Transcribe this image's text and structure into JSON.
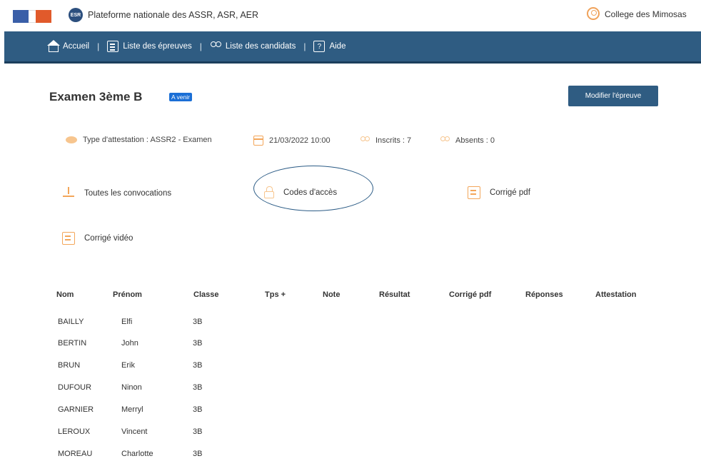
{
  "header": {
    "logo_text": "ESR",
    "platform_title": "Plateforme nationale des ASSR, ASR, AER",
    "user_name": "College des Mimosas"
  },
  "nav": {
    "home": "Accueil",
    "exams": "Liste des épreuves",
    "candidates": "Liste des candidats",
    "help": "Aide",
    "separator": "|"
  },
  "exam": {
    "title": "Examen 3ème B",
    "status_badge": "A venir",
    "modify_button": "Modifier l'épreuve"
  },
  "info": {
    "attestation_type": "Type d'attestation : ASSR2 - Examen",
    "datetime": "21/03/2022 10:00",
    "enrolled": "Inscrits : 7",
    "absent": "Absents : 0"
  },
  "actions": {
    "all_convocations": "Toutes les convocations",
    "access_codes": "Codes d'accès",
    "pdf_correction": "Corrigé pdf",
    "video_correction": "Corrigé vidéo"
  },
  "table": {
    "headers": {
      "nom": "Nom",
      "prenom": "Prénom",
      "classe": "Classe",
      "tps": "Tps +",
      "note": "Note",
      "resultat": "Résultat",
      "corrige_pdf": "Corrigé pdf",
      "reponses": "Réponses",
      "attestation": "Attestation"
    },
    "rows": [
      {
        "nom": "BAILLY",
        "prenom": "Elfi",
        "classe": "3B"
      },
      {
        "nom": "BERTIN",
        "prenom": "John",
        "classe": "3B"
      },
      {
        "nom": "BRUN",
        "prenom": "Erik",
        "classe": "3B"
      },
      {
        "nom": "DUFOUR",
        "prenom": "Ninon",
        "classe": "3B"
      },
      {
        "nom": "GARNIER",
        "prenom": "Merryl",
        "classe": "3B"
      },
      {
        "nom": "LEROUX",
        "prenom": "Vincent",
        "classe": "3B"
      },
      {
        "nom": "MOREAU",
        "prenom": "Charlotte",
        "classe": "3B"
      }
    ]
  },
  "colors": {
    "nav_blue": "#2f5c82",
    "badge_blue": "#1b6fd6",
    "accent_orange": "#f3a65a",
    "annotation_circle": "#2c5c86"
  }
}
